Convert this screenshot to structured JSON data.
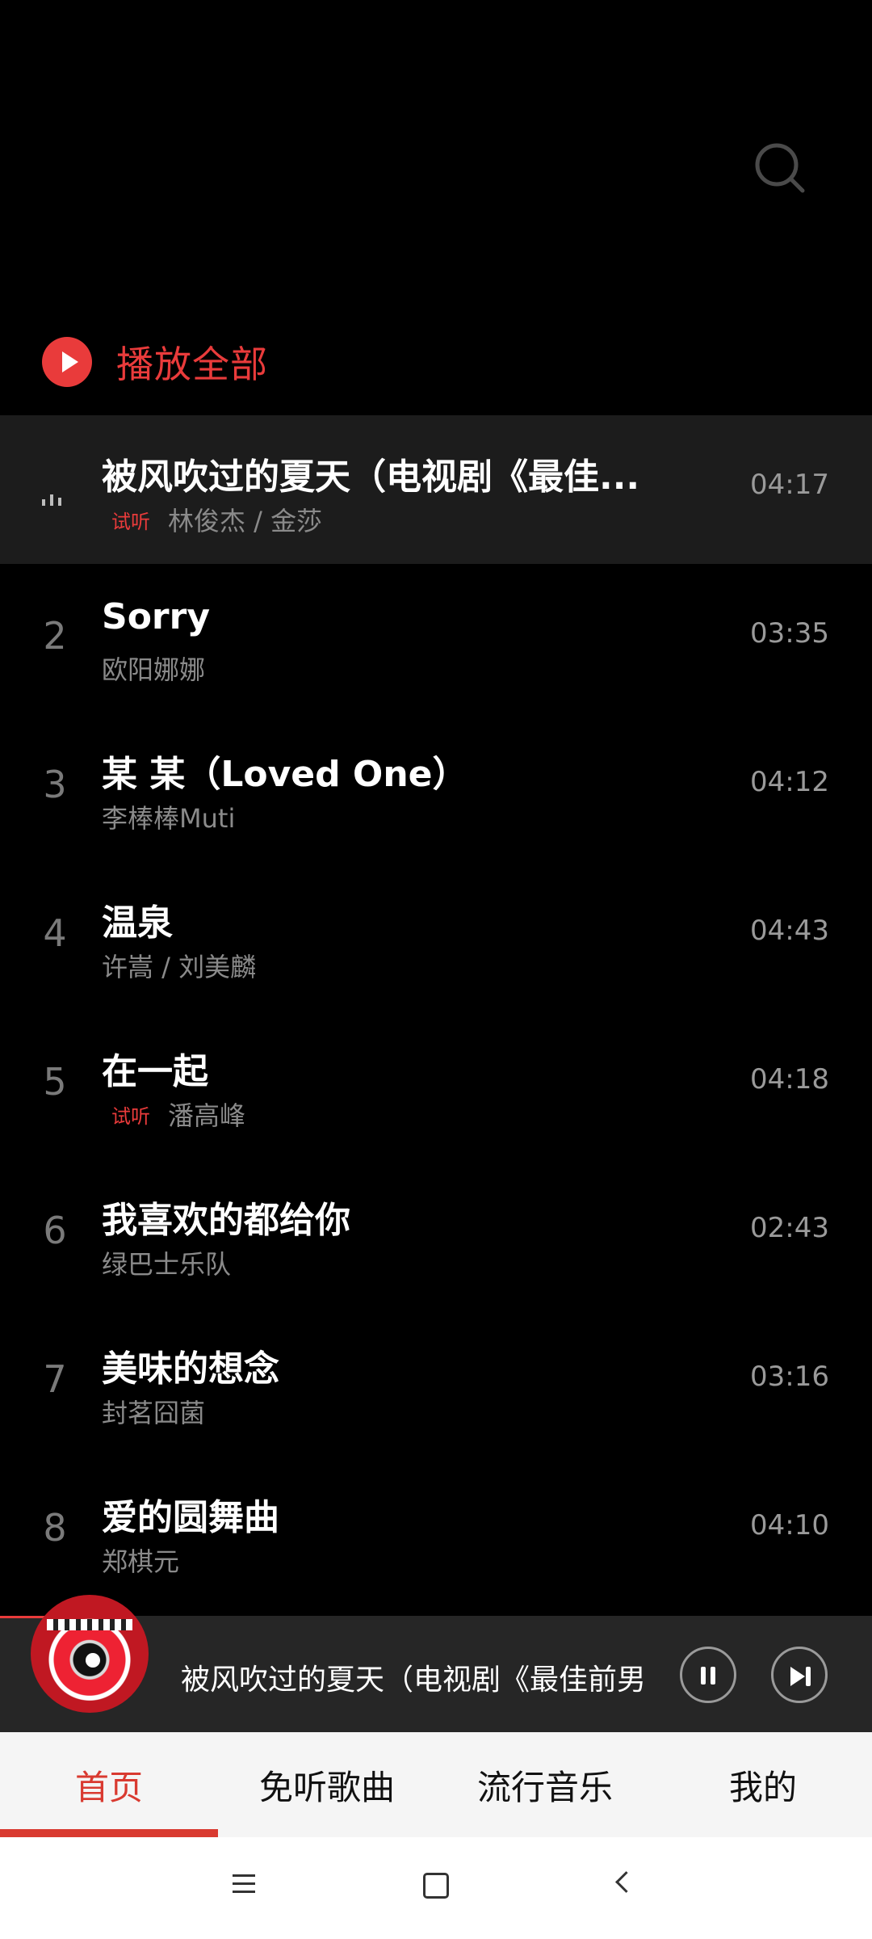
{
  "header": {
    "search_icon": "search-icon"
  },
  "play_all": {
    "label": "播放全部"
  },
  "songs": [
    {
      "index": "",
      "title": "被风吹过的夏天（电视剧《最佳...",
      "artist": "林俊杰 / 金莎",
      "trial": "试听",
      "duration": "04:17",
      "active": true
    },
    {
      "index": "2",
      "title": "Sorry",
      "artist": "欧阳娜娜",
      "trial": "",
      "duration": "03:35"
    },
    {
      "index": "3",
      "title": "某 某（Loved One）",
      "artist": "李棒棒Muti",
      "trial": "",
      "duration": "04:12"
    },
    {
      "index": "4",
      "title": "温泉",
      "artist": "许嵩 / 刘美麟",
      "trial": "",
      "duration": "04:43"
    },
    {
      "index": "5",
      "title": "在一起",
      "artist": "潘高峰",
      "trial": "试听",
      "duration": "04:18"
    },
    {
      "index": "6",
      "title": "我喜欢的都给你",
      "artist": "绿巴士乐队",
      "trial": "",
      "duration": "02:43"
    },
    {
      "index": "7",
      "title": "美味的想念",
      "artist": "封茗囧菌",
      "trial": "",
      "duration": "03:16"
    },
    {
      "index": "8",
      "title": "爱的圆舞曲",
      "artist": "郑棋元",
      "trial": "",
      "duration": "04:10"
    }
  ],
  "mini_player": {
    "title": "被风吹过的夏天（电视剧《最佳前男"
  },
  "tabs": [
    {
      "label": "首页",
      "active": true
    },
    {
      "label": "免听歌曲"
    },
    {
      "label": "流行音乐"
    },
    {
      "label": "我的"
    }
  ],
  "colors": {
    "accent": "#e93b3b",
    "background": "#000000",
    "tab_active": "#d93a30"
  }
}
